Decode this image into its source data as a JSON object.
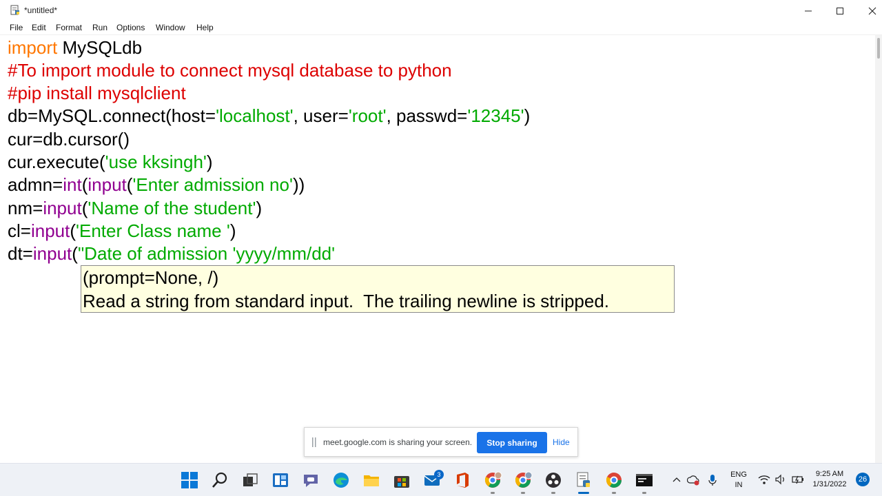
{
  "window": {
    "title": "*untitled*"
  },
  "menu": [
    "File",
    "Edit",
    "Format",
    "Run",
    "Options",
    "Window",
    "Help"
  ],
  "code": {
    "line1": {
      "keyword": "import",
      "rest": " MySQLdb"
    },
    "line2": "#To import module to connect mysql database to python",
    "line3": "#pip install mysqlclient",
    "line4": {
      "a": "db=MySQL.connect(host=",
      "b": "'localhost'",
      "c": ", user=",
      "d": "'root'",
      "e": ", passwd=",
      "f": "'12345'",
      "g": ")"
    },
    "line5": "cur=db.cursor()",
    "line6": {
      "a": "cur.execute(",
      "b": "'use kksingh'",
      "c": ")"
    },
    "line7": {
      "a": "admn=",
      "b": "int",
      "c": "(",
      "d": "input",
      "e": "(",
      "f": "'Enter admission no'",
      "g": "))"
    },
    "line8": {
      "a": "nm=",
      "b": "input",
      "c": "(",
      "d": "'Name of the student'",
      "e": ")"
    },
    "line9": {
      "a": "cl=",
      "b": "input",
      "c": "(",
      "d": "'Enter Class name '",
      "e": ")"
    },
    "line10": {
      "a": "dt=",
      "b": "input",
      "c": "(",
      "d": "\"Date of admission 'yyyy/mm/dd'"
    }
  },
  "calltip": {
    "signature": "(prompt=None, /)",
    "doc": "Read a string from standard input.  The trailing newline is stripped."
  },
  "share_bar": {
    "message": "meet.google.com is sharing your screen.",
    "stop_label": "Stop sharing",
    "hide_label": "Hide"
  },
  "taskbar": {
    "mail_badge": "3",
    "language": "ENG",
    "region": "IN",
    "time": "9:25 AM",
    "date": "1/31/2022",
    "notifications": "26",
    "icons": [
      "start-icon",
      "search-icon",
      "task-view-icon",
      "widgets-icon",
      "teams-chat-icon",
      "edge-icon",
      "file-explorer-icon",
      "store-icon",
      "mail-icon",
      "office-icon",
      "chrome-profile-icon",
      "chrome-profile-icon-2",
      "obs-icon",
      "python-idle-icon",
      "chrome-icon",
      "mysql-console-icon"
    ]
  },
  "colors": {
    "keyword": "#ff7700",
    "comment": "#dd0000",
    "string": "#00aa00",
    "builtin": "#900090",
    "calltip_bg": "#ffffe0",
    "accent": "#1a73e8"
  }
}
